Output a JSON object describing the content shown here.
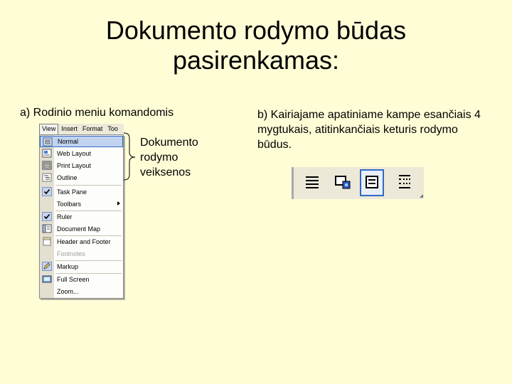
{
  "slide": {
    "title_line1": "Dokumento rodymo būdas",
    "title_line2": "pasirenkamas:",
    "caption_a": "a) Rodinio meniu komandomis",
    "callout_line1": "Dokumento",
    "callout_line2": "rodymo",
    "callout_line3": "veiksenos",
    "caption_b": "b) Kairiajame apatiniame kampe esančiais 4 mygtukais, atitinkančiais keturis rodymo būdus."
  },
  "menubar": {
    "items": [
      "View",
      "Insert",
      "Format",
      "Too"
    ]
  },
  "view_menu": {
    "items": [
      {
        "label": "Normal",
        "icon": "normal-view-icon",
        "selected": true
      },
      {
        "label": "Web Layout",
        "icon": "web-layout-icon"
      },
      {
        "label": "Print Layout",
        "icon": "print-layout-icon"
      },
      {
        "label": "Outline",
        "icon": "outline-view-icon"
      },
      {
        "label": "Task Pane",
        "icon": "checkmark-icon"
      },
      {
        "label": "Toolbars",
        "icon": "",
        "submenu": true
      },
      {
        "label": "Ruler",
        "icon": "checkmark-icon"
      },
      {
        "label": "Document Map",
        "icon": "document-map-icon"
      },
      {
        "label": "Header and Footer",
        "icon": "header-footer-icon"
      },
      {
        "label": "Footnotes",
        "icon": "",
        "disabled": true
      },
      {
        "label": "Markup",
        "icon": "markup-icon"
      },
      {
        "label": "Full Screen",
        "icon": "full-screen-icon"
      },
      {
        "label": "Zoom...",
        "icon": ""
      }
    ]
  },
  "view_buttons": {
    "items": [
      "normal-view-icon",
      "web-layout-icon",
      "print-layout-icon",
      "outline-view-icon"
    ],
    "active": "print-layout-icon"
  },
  "colors": {
    "background": "#fffdd6",
    "selection": "#c1d2ee",
    "selection_border": "#316ac5",
    "menu_face": "#ece9d8"
  }
}
